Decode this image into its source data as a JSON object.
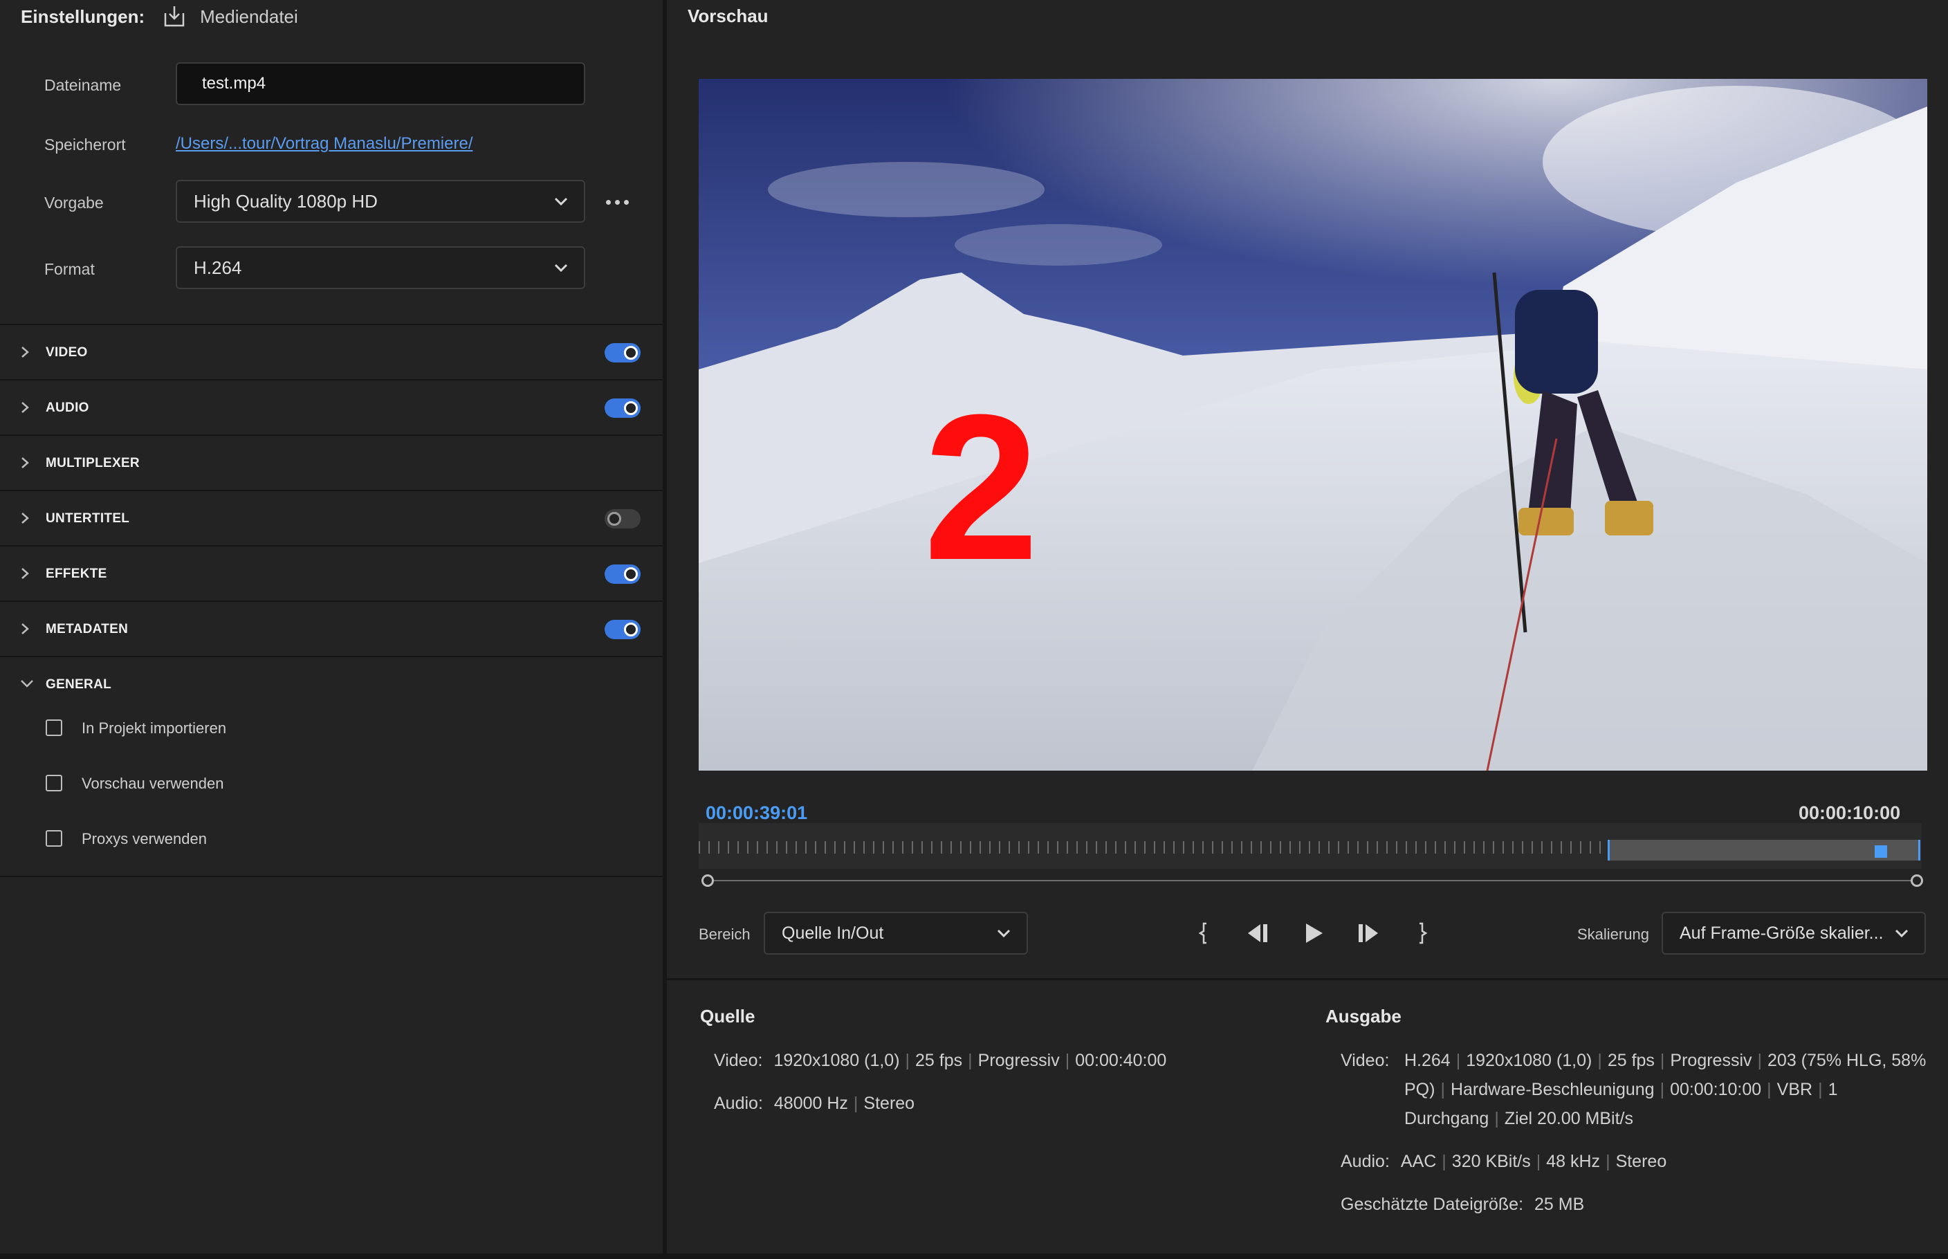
{
  "left": {
    "header": {
      "title": "Einstellungen:",
      "file_label": "Mediendatei"
    },
    "fields": {
      "filename_label": "Dateiname",
      "filename_value": "test.mp4",
      "location_label": "Speicherort",
      "location_value": "/Users/...tour/Vortrag Manaslu/Premiere/",
      "preset_label": "Vorgabe",
      "preset_value": "High Quality 1080p HD",
      "format_label": "Format",
      "format_value": "H.264"
    },
    "sections": [
      {
        "label": "VIDEO",
        "toggle": "on"
      },
      {
        "label": "AUDIO",
        "toggle": "on"
      },
      {
        "label": "MULTIPLEXER",
        "toggle": "none"
      },
      {
        "label": "UNTERTITEL",
        "toggle": "off"
      },
      {
        "label": "EFFEKTE",
        "toggle": "on"
      },
      {
        "label": "METADATEN",
        "toggle": "on"
      },
      {
        "label": "GENERAL",
        "toggle": "none",
        "expanded": true
      }
    ],
    "general_options": [
      {
        "label": "In Projekt importieren",
        "checked": false
      },
      {
        "label": "Vorschau verwenden",
        "checked": false
      },
      {
        "label": "Proxys verwenden",
        "checked": false
      }
    ]
  },
  "preview": {
    "title": "Vorschau",
    "overlay_number": "2",
    "current_time": "00:00:39:01",
    "duration": "00:00:10:00",
    "range_label": "Bereich",
    "range_value": "Quelle In/Out",
    "scale_label": "Skalierung",
    "scale_value": "Auf Frame-Größe skalier..."
  },
  "info": {
    "source": {
      "title": "Quelle",
      "video_key": "Video:",
      "video": [
        "1920x1080 (1,0)",
        "25 fps",
        "Progressiv",
        "00:00:40:00"
      ],
      "audio_key": "Audio:",
      "audio": [
        "48000 Hz",
        "Stereo"
      ]
    },
    "output": {
      "title": "Ausgabe",
      "video_key": "Video:",
      "video_line1": [
        "H.264",
        "1920x1080 (1,0)",
        "25 fps",
        "Progressiv",
        "203 (75% HLG, 58%"
      ],
      "video_line2": [
        "PQ)",
        "Hardware-Beschleunigung",
        "00:00:10:00",
        "VBR",
        "1"
      ],
      "video_line3": [
        "Durchgang",
        "Ziel 20.00 MBit/s"
      ],
      "audio_key": "Audio:",
      "audio": [
        "AAC",
        "320 KBit/s",
        "48 kHz",
        "Stereo"
      ],
      "size_key": "Geschätzte Dateigröße:",
      "size_value": "25 MB"
    }
  },
  "colors": {
    "accent": "#3a78e0",
    "timecode_current": "#4a9cf5",
    "overlay_number": "#ff0d0d"
  }
}
